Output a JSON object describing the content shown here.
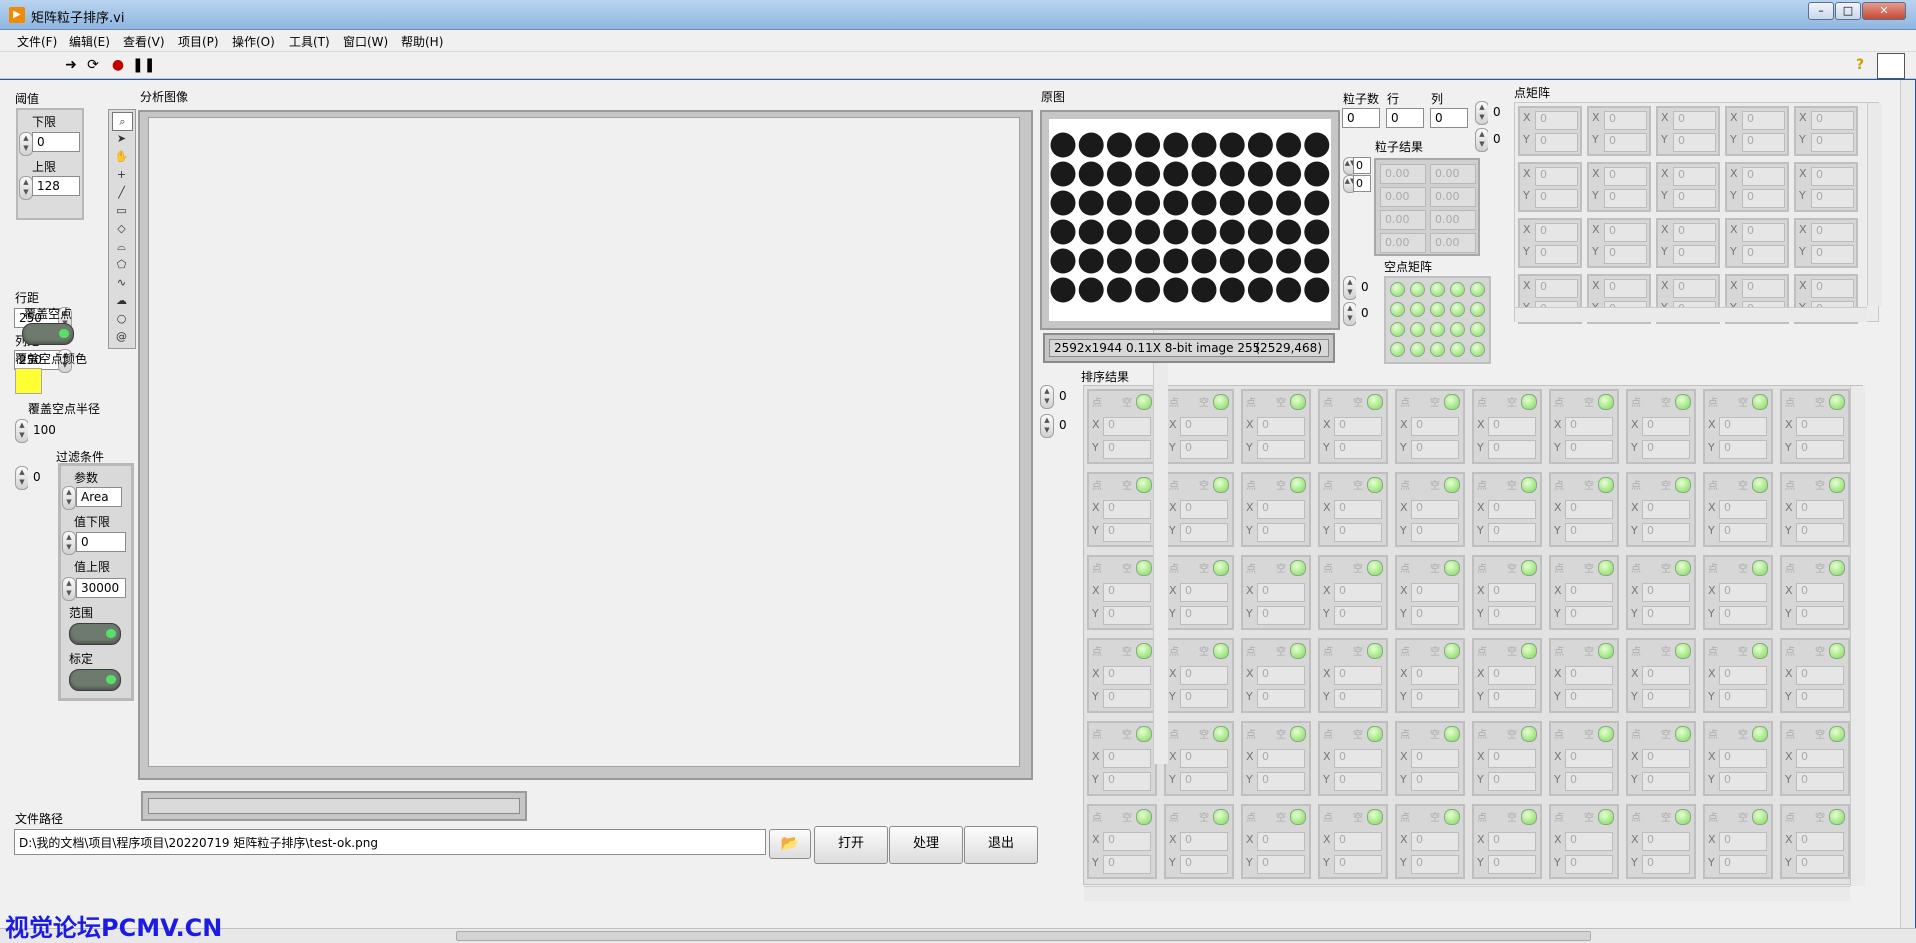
{
  "window": {
    "title": "矩阵粒子排序.vi"
  },
  "menu": [
    "文件(F)",
    "编辑(E)",
    "查看(V)",
    "项目(P)",
    "操作(O)",
    "工具(T)",
    "窗口(W)",
    "帮助(H)"
  ],
  "left": {
    "threshold_label": "阈值",
    "lower_label": "下限",
    "lower_value": "0",
    "upper_label": "上限",
    "upper_value": "128",
    "row_spacing_label": "行距",
    "row_spacing_value": "250",
    "col_spacing_label": "列距",
    "col_spacing_value": "250",
    "cover_empty_label": "覆盖空点",
    "cover_color_label": "覆盖空点颜色",
    "cover_color": "#ffff33",
    "cover_radius_label": "覆盖空点半径",
    "cover_radius_value": "100",
    "filter_label": "过滤条件",
    "filter_index": "0",
    "param_label": "参数",
    "param_value": "Area",
    "min_label": "值下限",
    "min_value": "0",
    "max_label": "值上限",
    "max_value": "30000",
    "range_label": "范围",
    "calib_label": "标定"
  },
  "analysis": {
    "label": "分析图像"
  },
  "file": {
    "label": "文件路径",
    "path": "D:\\我的文档\\项目\\程序项目\\20220719 矩阵粒子排序\\test-ok.png",
    "open": "打开",
    "process": "处理",
    "exit": "退出"
  },
  "original": {
    "label": "原图",
    "status": "2592x1944 0.11X 8-bit image 255",
    "coords": "(2529,468)",
    "rows": 6,
    "cols": 10
  },
  "counts": {
    "particles_label": "粒子数",
    "particles_value": "0",
    "row_label": "行",
    "row_value": "0",
    "col_label": "列",
    "col_value": "0"
  },
  "particle_result": {
    "label": "粒子结果",
    "idx1": "0",
    "idx2": "0",
    "cells": [
      "0.00",
      "0.00",
      "0.00",
      "0.00",
      "0.00",
      "0.00",
      "0.00",
      "0.00"
    ]
  },
  "empty_matrix": {
    "label": "空点矩阵",
    "idx1": "0",
    "idx2": "0"
  },
  "point_matrix": {
    "label": "点矩阵",
    "idx1": "0",
    "idx2": "0"
  },
  "sort_result": {
    "label": "排序结果",
    "idx1": "0",
    "idx2": "0",
    "point_char": "点",
    "empty_char": "空"
  },
  "cell": {
    "x_label": "X",
    "y_label": "Y",
    "value": "0"
  },
  "watermark": "视觉论坛PCMV.CN"
}
